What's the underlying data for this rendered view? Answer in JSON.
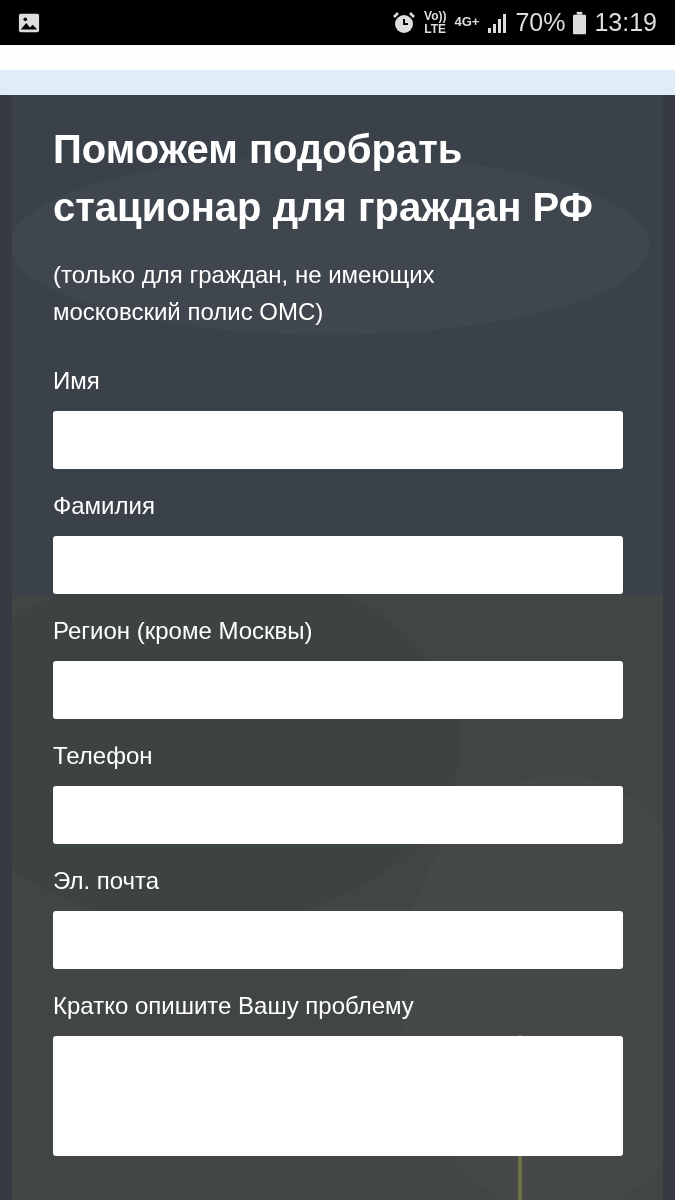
{
  "status_bar": {
    "volte": "Vo))",
    "lte": "LTE",
    "network": "4G+",
    "battery": "70%",
    "time": "13:19"
  },
  "form": {
    "title": "Поможем подобрать стационар для граждан РФ",
    "subtitle": "(только для граждан, не имеющих московский полис ОМС)",
    "fields": [
      {
        "label": "Имя",
        "kind": "input"
      },
      {
        "label": "Фамилия",
        "kind": "input"
      },
      {
        "label": "Регион (кроме Москвы)",
        "kind": "input"
      },
      {
        "label": "Телефон",
        "kind": "input"
      },
      {
        "label": "Эл. почта",
        "kind": "input"
      },
      {
        "label": "Кратко опишите Вашу проблему",
        "kind": "textarea"
      }
    ]
  }
}
